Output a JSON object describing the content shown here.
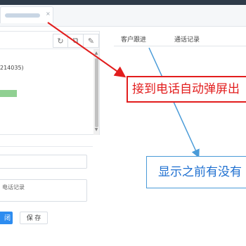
{
  "tab": {
    "label": "",
    "close_glyph": "×"
  },
  "toolbar": {
    "refresh_icon": "↻",
    "copy_icon": "⧉",
    "edit_icon": "✎"
  },
  "customer": {
    "phone_code": "214035)"
  },
  "scrollbar": {
    "up": "▲",
    "down": "▼"
  },
  "form": {
    "select_value": "",
    "note_text": "电话记录",
    "close_label": "闭",
    "save_label": "保 存"
  },
  "right_tabs": [
    {
      "label": "客户跟进"
    },
    {
      "label": "通话记录"
    }
  ],
  "annotations": {
    "red": "接到电话自动弹屏出",
    "blue": "显示之前有没有"
  },
  "colors": {
    "accent": "#2d8cf0",
    "red": "#e21d1d",
    "blue_text": "#1e6fd0",
    "blue_border": "#4a9bd8",
    "green": "#90d092"
  }
}
